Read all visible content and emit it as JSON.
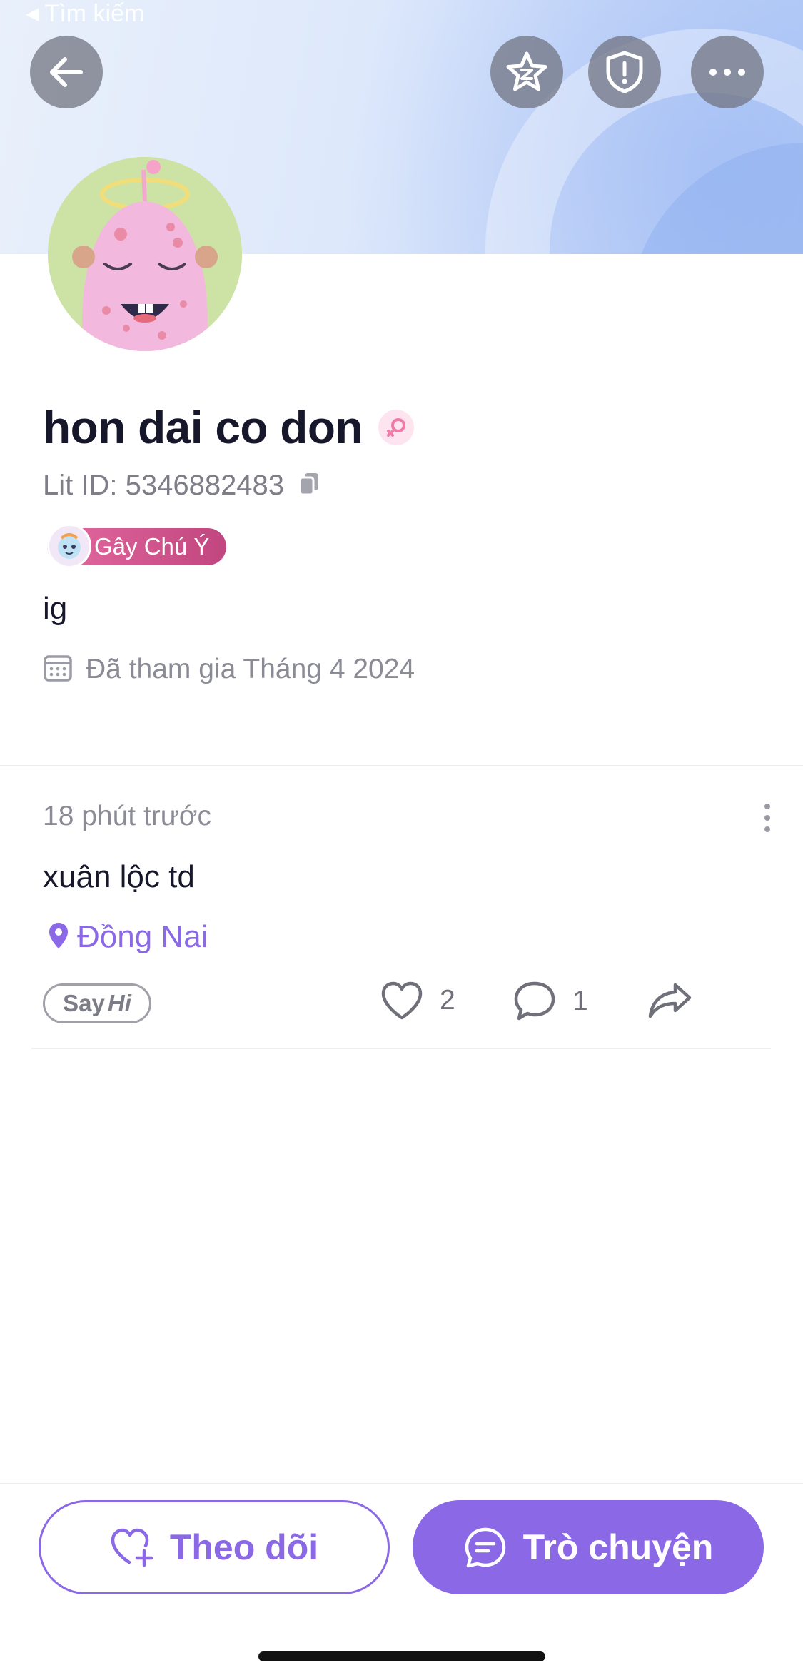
{
  "status_bar": {
    "back_label": "Tìm kiếm"
  },
  "profile": {
    "name": "hon dai co don",
    "lit_id": "Lit ID: 5346882483",
    "tag": "Gây Chú Ý",
    "bio": "ig",
    "joined": "Đã tham gia Tháng 4 2024"
  },
  "post": {
    "time": "18 phút trước",
    "text": "xuân lộc td",
    "location": "Đồng Nai",
    "sayhi_a": "Say",
    "sayhi_b": "Hi",
    "likes": "2",
    "comments": "1"
  },
  "actions": {
    "follow_label": "Theo dõi",
    "chat_label": "Trò chuyện"
  },
  "colors": {
    "accent": "#8a68e6",
    "tag_gradient_start": "#e46aa0",
    "tag_gradient_end": "#c1467f",
    "gender_pink": "#f07aa8"
  },
  "icons": [
    "back-arrow-icon",
    "star-icon",
    "shield-icon",
    "more-icon",
    "female-icon",
    "copy-icon",
    "calendar-icon",
    "location-pin-icon",
    "heart-icon",
    "comment-icon",
    "share-icon",
    "heart-plus-icon",
    "chat-icon"
  ]
}
